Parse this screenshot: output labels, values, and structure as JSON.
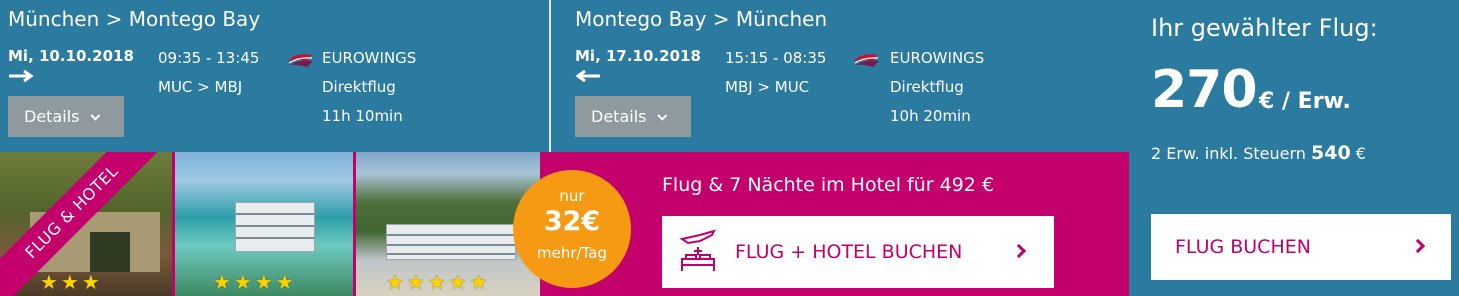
{
  "outbound": {
    "route": "München > Montego Bay",
    "date": "Mi, 10.10.2018",
    "times": "09:35 - 13:45",
    "codes": "MUC > MBJ",
    "airline": "EUROWINGS",
    "type": "Direktflug",
    "duration": "11h 10min",
    "details_label": "Details"
  },
  "return": {
    "route": "Montego Bay > München",
    "date": "Mi, 17.10.2018",
    "times": "15:15 - 08:35",
    "codes": "MBJ > MUC",
    "airline": "EUROWINGS",
    "type": "Direktflug",
    "duration": "10h 20min",
    "details_label": "Details"
  },
  "price": {
    "heading": "Ihr gewählter Flug:",
    "amount": "270",
    "unit": "€ / Erw.",
    "total_prefix": "2 Erw. inkl. Steuern",
    "total_value": "540",
    "total_currency": "€",
    "book_label": "FLUG BUCHEN"
  },
  "package": {
    "ribbon": "FLUG & HOTEL",
    "badge_top": "nur",
    "badge_price": "32€",
    "badge_bottom": "mehr/Tag",
    "title": "Flug & 7 Nächte im Hotel für 492 €",
    "button_label": "FLUG + HOTEL BUCHEN",
    "hotels": [
      {
        "stars": 3,
        "stars_text": "★★★"
      },
      {
        "stars": 4,
        "stars_text": "★★★★"
      },
      {
        "stars": 5,
        "stars_text": "★★★★★"
      }
    ]
  },
  "colors": {
    "panel_blue": "#2b7aa0",
    "magenta": "#c4006c",
    "badge_orange": "#f59a12",
    "button_gray": "#8f9a9f",
    "star_yellow": "#ffd200"
  },
  "icons": {
    "outbound_arrow": "arrow-right-icon",
    "return_arrow": "arrow-left-icon",
    "airline_logo": "eurowings-logo-icon",
    "details_chevron": "chevron-down-icon",
    "book_chevron": "chevron-right-icon",
    "package_icon": "plane-bed-icon"
  }
}
